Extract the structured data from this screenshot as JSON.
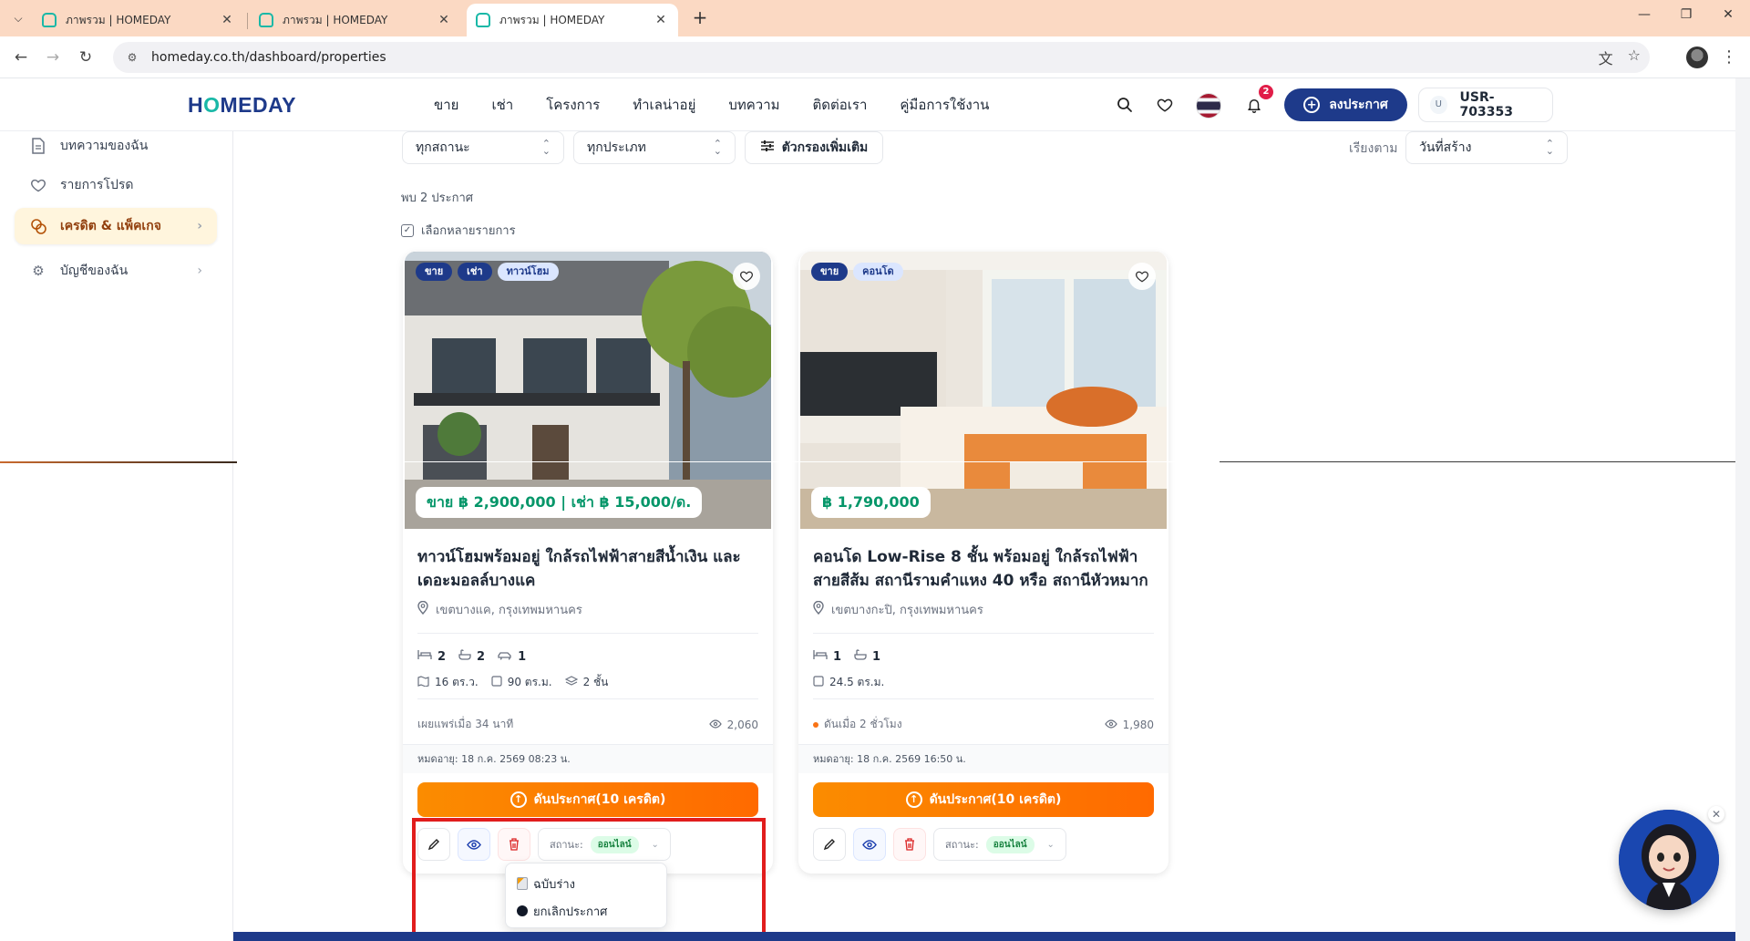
{
  "browser": {
    "tabs": [
      {
        "title": "ภาพรวม | HOMEDAY",
        "active": false
      },
      {
        "title": "ภาพรวม | HOMEDAY",
        "active": false
      },
      {
        "title": "ภาพรวม | HOMEDAY",
        "active": true
      }
    ],
    "url": "homeday.co.th/dashboard/properties"
  },
  "header": {
    "logo_pre": "H",
    "logo_o": "O",
    "logo_post": "MEDAY",
    "nav": [
      "ขาย",
      "เช่า",
      "โครงการ",
      "ทำเลน่าอยู่",
      "บทความ",
      "ติดต่อเรา",
      "คู่มือการใช้งาน"
    ],
    "notification_count": "2",
    "post_button": "ลงประกาศ",
    "user_initial": "U",
    "user_id": "USR-703353"
  },
  "sidebar": {
    "items": [
      {
        "label": "บทความของฉัน",
        "icon": "document-icon"
      },
      {
        "label": "รายการโปรด",
        "icon": "heart-icon"
      },
      {
        "label": "เครดิต & แพ็คเกจ",
        "icon": "coins-icon"
      },
      {
        "label": "บัญชีของฉัน",
        "icon": "gear-icon"
      }
    ]
  },
  "filters": {
    "status": "ทุกสถานะ",
    "type": "ทุกประเภท",
    "more_filters": "ตัวกรองเพิ่มเติม",
    "sort_label": "เรียงตาม",
    "sort_value": "วันที่สร้าง",
    "result_count": "พบ 2 ประกาศ",
    "multi_select": "เลือกหลายรายการ"
  },
  "listings": [
    {
      "badges": [
        "ขาย",
        "เช่า",
        "ทาวน์โฮม"
      ],
      "price": "ขาย ฿ 2,900,000 | เช่า ฿ 15,000/ด.",
      "title": "ทาวน์โฮมพร้อมอยู่ ใกล้รถไฟฟ้าสายสีน้ำเงิน และเดอะมอลล์บางแค",
      "location": "เขตบางแค, กรุงเทพมหานคร",
      "bedrooms": "2",
      "bathrooms": "2",
      "parking": "1",
      "land": "16 ตร.ว.",
      "area": "90 ตร.ม.",
      "floors": "2 ชั้น",
      "published": "เผยแพร่เมื่อ 34 นาที",
      "views": "2,060",
      "expiry": "หมดอายุ: 18 ก.ค. 2569 08:23 น.",
      "boost": "ดันประกาศ(10 เครดิต)",
      "status_label": "สถานะ:",
      "status": "ออนไลน์"
    },
    {
      "badges": [
        "ขาย",
        "คอนโด"
      ],
      "price": "฿ 1,790,000",
      "title": "คอนโด Low-Rise 8 ชั้น พร้อมอยู่ ใกล้รถไฟฟ้าสายสีส้ม สถานีรามคำแหง 40 หรือ สถานีหัวหมาก",
      "location": "เขตบางกะปิ, กรุงเทพมหานคร",
      "bedrooms": "1",
      "bathrooms": "1",
      "area": "24.5 ตร.ม.",
      "published": "ดันเมื่อ 2 ชั่วโมง",
      "views": "1,980",
      "expiry": "หมดอายุ: 18 ก.ค. 2569 16:50 น.",
      "boost": "ดันประกาศ(10 เครดิต)",
      "status_label": "สถานะ:",
      "status": "ออนไลน์"
    }
  ],
  "status_dropdown": {
    "options": [
      "ฉบับร่าง",
      "ยกเลิกประกาศ"
    ]
  },
  "colors": {
    "brand_navy": "#1e3a8a",
    "brand_teal": "#19b8a7",
    "price_green": "#059669",
    "boost_orange": "#ff6a00",
    "highlight_red": "#e11d1d"
  }
}
